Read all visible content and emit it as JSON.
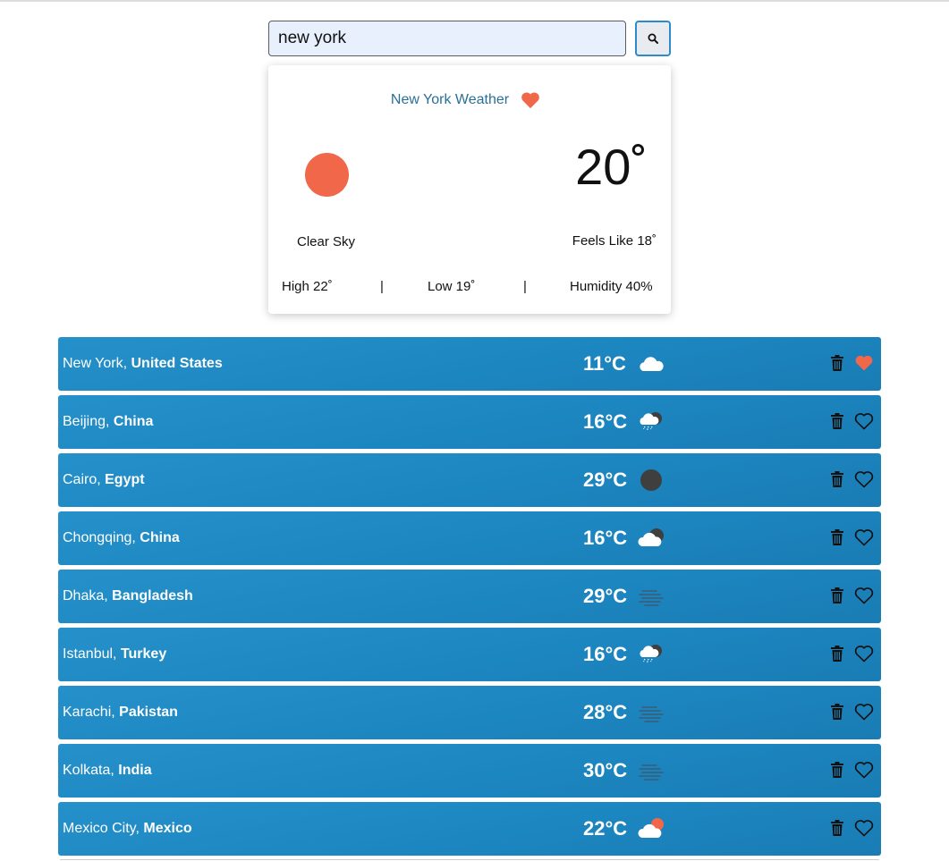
{
  "search": {
    "value": "new york",
    "button_icon": "search-icon"
  },
  "card": {
    "title": "New York Weather",
    "favorite_icon": "heart-filled-icon",
    "condition_icon": "sun-icon",
    "temperature": "20˚",
    "condition": "Clear Sky",
    "feels_like": "Feels Like 18˚",
    "high": "High 22˚",
    "separator": "|",
    "low": "Low 19˚",
    "humidity": "Humidity 40%"
  },
  "colors": {
    "accent": "#f0674a",
    "row_bg": "#1f88c2",
    "title": "#2a6f96"
  },
  "cities": [
    {
      "city": "New York",
      "country": "United States",
      "temp": "11°C",
      "icon": "cloud",
      "favorite": true
    },
    {
      "city": "Beijing",
      "country": "China",
      "temp": "16°C",
      "icon": "rain-night",
      "favorite": false
    },
    {
      "city": "Cairo",
      "country": "Egypt",
      "temp": "29°C",
      "icon": "moon",
      "favorite": false
    },
    {
      "city": "Chongqing",
      "country": "China",
      "temp": "16°C",
      "icon": "cloud-night",
      "favorite": false
    },
    {
      "city": "Dhaka",
      "country": "Bangladesh",
      "temp": "29°C",
      "icon": "mist",
      "favorite": false
    },
    {
      "city": "Istanbul",
      "country": "Turkey",
      "temp": "16°C",
      "icon": "rain-night",
      "favorite": false
    },
    {
      "city": "Karachi",
      "country": "Pakistan",
      "temp": "28°C",
      "icon": "mist",
      "favorite": false
    },
    {
      "city": "Kolkata",
      "country": "India",
      "temp": "30°C",
      "icon": "mist",
      "favorite": false
    },
    {
      "city": "Mexico City",
      "country": "Mexico",
      "temp": "22°C",
      "icon": "cloud-sun",
      "favorite": false
    }
  ]
}
